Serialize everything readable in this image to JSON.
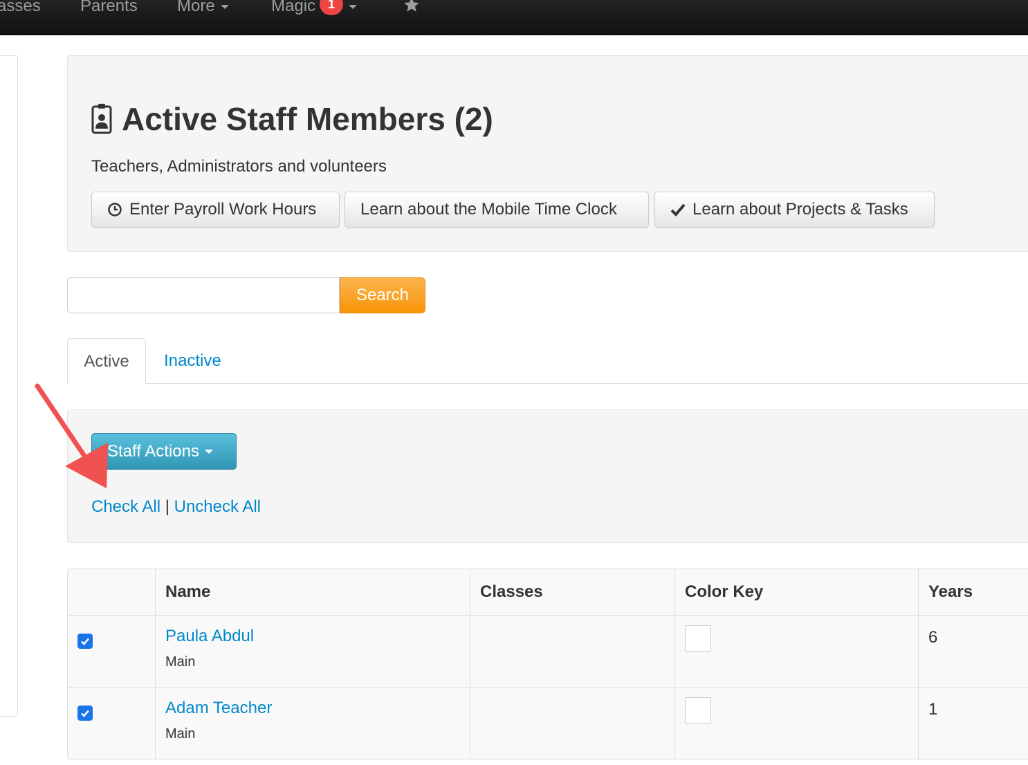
{
  "nav": {
    "items": [
      "asses",
      "Parents",
      "More",
      "Magic"
    ],
    "magic_badge": "1",
    "icons": [
      "star-icon"
    ]
  },
  "header": {
    "title": "Active Staff Members (2)",
    "subtitle": "Teachers, Administrators and volunteers",
    "buttons": [
      {
        "label": "Enter Payroll Work Hours",
        "icon": "clock-icon"
      },
      {
        "label": "Learn about the Mobile Time Clock"
      },
      {
        "label": "Learn about Projects & Tasks",
        "icon": "check-icon"
      }
    ]
  },
  "search": {
    "value": "",
    "button_label": "Search",
    "button_color": "#f89406"
  },
  "tabs": [
    {
      "label": "Active",
      "selected": true
    },
    {
      "label": "Inactive",
      "selected": false
    }
  ],
  "actions": {
    "staff_actions_label": "Staff Actions",
    "check_all": "Check All",
    "separator": "|",
    "uncheck_all": "Uncheck All"
  },
  "table": {
    "columns": [
      "",
      "Name",
      "Classes",
      "Color Key",
      "Years"
    ],
    "rows": [
      {
        "checked": true,
        "name": "Paula Abdul",
        "location": "Main",
        "classes": "",
        "years": "6"
      },
      {
        "checked": true,
        "name": "Adam Teacher",
        "location": "Main",
        "classes": "",
        "years": "1"
      }
    ]
  },
  "colors": {
    "link": "#0088cc",
    "info_button": "#2f96b4",
    "annotation_arrow": "#f0524f"
  }
}
